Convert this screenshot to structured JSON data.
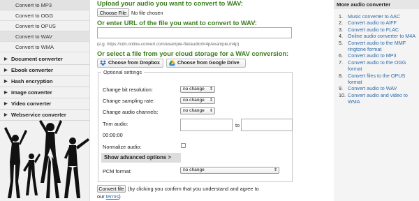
{
  "sidebar": {
    "sub_items": [
      {
        "label": "Convert to MP3",
        "active": true
      },
      {
        "label": "Convert to OGG",
        "active": false
      },
      {
        "label": "Convert to OPUS",
        "active": false
      },
      {
        "label": "Convert to WAV",
        "active": true
      },
      {
        "label": "Convert to WMA",
        "active": false
      }
    ],
    "categories": [
      "Document converter",
      "Ebook converter",
      "Hash encryption",
      "Image converter",
      "Video converter",
      "Webservice converter"
    ]
  },
  "main": {
    "upload_heading": "Upload your audio you want to convert to WAV:",
    "choose_file_label": "Choose File",
    "no_file_text": "No file chosen",
    "url_heading": "Or enter URL of the file you want to convert to WAV:",
    "url_value": "",
    "url_hint": "(e.g. https://cdn.online-convert.com/example-file/audio/m4p/example.m4p)",
    "cloud_heading": "Or select a file from your cloud storage for a WAV conversion:",
    "dropbox_label": "Choose from Dropbox",
    "gdrive_label": "Choose from Google Drive",
    "options_legend": "Optional settings",
    "bit_res_label": "Change bit resolution:",
    "bit_res_value": "no change",
    "sampling_label": "Change sampling rate:",
    "sampling_value": "no change",
    "channels_label": "Change audio channels:",
    "channels_value": "no change",
    "trim_label": "Trim audio:",
    "trim_start_value": "",
    "trim_to_label": "to",
    "trim_end_value": "",
    "trim_default": "00:00:00",
    "normalize_label": "Normalize audio:",
    "normalize_checked": false,
    "advanced_label": "Show advanced options >",
    "pcm_label": "PCM format:",
    "pcm_value": "no change",
    "convert_label": "Convert file",
    "terms_text": "(by clicking you confirm that you understand and agree to",
    "terms_prefix": "our",
    "terms_link": "terms",
    "terms_suffix": ")"
  },
  "rightbar": {
    "title": "More audio converter",
    "items": [
      {
        "num": "1.",
        "label": "Music converter to AAC"
      },
      {
        "num": "2.",
        "label": "Convert audio to AIFF"
      },
      {
        "num": "3.",
        "label": "Convert audio to FLAC"
      },
      {
        "num": "4.",
        "label": "Online audio converter to M4A"
      },
      {
        "num": "5.",
        "label": "Convert audio to the MMF ringtone format"
      },
      {
        "num": "6.",
        "label": "Convert audio to MP3"
      },
      {
        "num": "7.",
        "label": "Convert audio to the OGG format"
      },
      {
        "num": "8.",
        "label": "Convert files to the OPUS format"
      },
      {
        "num": "9.",
        "label": "Convert audio to WAV"
      },
      {
        "num": "10.",
        "label": "Convert audio and video to WMA"
      }
    ]
  },
  "colors": {
    "heading_green": "#3a7d1c",
    "link_blue": "#2e6aa8",
    "sidebar_bg": "#f1f1f1"
  }
}
